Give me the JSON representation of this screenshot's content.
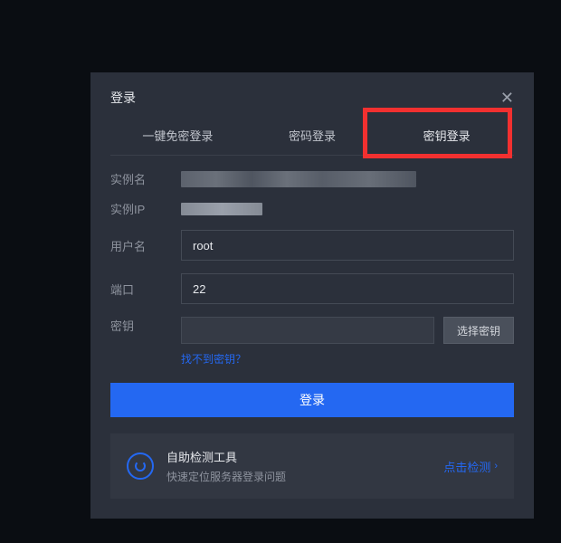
{
  "modal": {
    "title": "登录",
    "close_symbol": "✕"
  },
  "tabs": {
    "quick_login": "一键免密登录",
    "password_login": "密码登录",
    "key_login": "密钥登录"
  },
  "form": {
    "instance_name_label": "实例名",
    "instance_ip_label": "实例IP",
    "username_label": "用户名",
    "username_value": "root",
    "port_label": "端口",
    "port_value": "22",
    "key_label": "密钥",
    "select_key_btn": "选择密钥",
    "find_key_link": "找不到密钥？"
  },
  "actions": {
    "login_button": "登录"
  },
  "detect": {
    "title": "自助检测工具",
    "subtitle": "快速定位服务器登录问题",
    "action": "点击检测",
    "chevron": "›"
  }
}
